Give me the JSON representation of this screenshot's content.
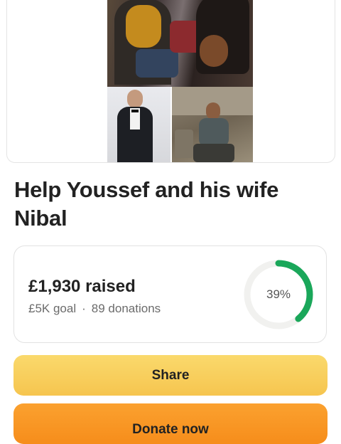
{
  "campaign": {
    "title": "Help Youssef and his wife Nibal",
    "raised": "£1,930 raised",
    "goal": "£5K goal",
    "separator": "·",
    "donations": "89 donations",
    "percent_label": "39%",
    "progress_fraction": 0.39
  },
  "actions": {
    "share_label": "Share",
    "donate_label": "Donate now"
  },
  "colors": {
    "progress": "#1aa75a",
    "track": "#f1f1ef",
    "share": "#f7c94f",
    "donate": "#f7901e"
  },
  "photos": [
    "photo-man-with-dog",
    "photo-man-in-suit",
    "photo-man-in-rubble"
  ]
}
